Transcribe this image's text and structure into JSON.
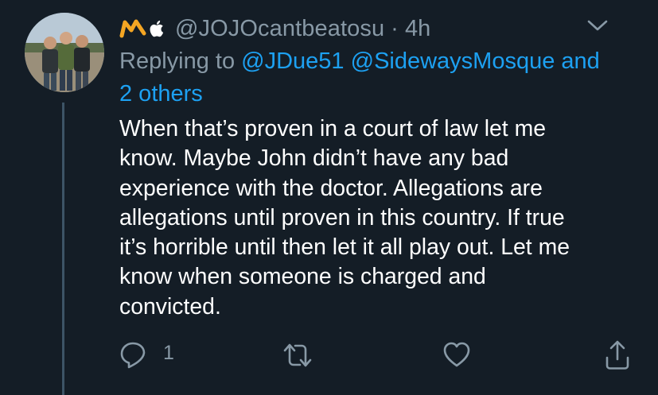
{
  "tweet": {
    "handle": "@JOJOcantbeatosu",
    "separator": "·",
    "time": "4h",
    "replying_prefix": "Replying to ",
    "reply_mention_1": "@JDue51",
    "reply_mention_2": "@SidewaysMosque",
    "reply_and": "and",
    "reply_others": "2 others",
    "body": "When that’s proven in a court of law let me\nknow. Maybe John didn’t have any bad\nexperience with the doctor. Allegations are\nallegations until proven in this country. If true\nit’s horrible until then let it all play out.  Let me\nknow when someone is charged and\nconvicted.",
    "reply_count": "1",
    "icons": {
      "name_emoji": "m-emoji-icon",
      "apple": "apple-logo-icon",
      "menu": "chevron-down-icon",
      "reply": "reply-icon",
      "retweet": "retweet-icon",
      "like": "heart-icon",
      "share": "share-icon"
    }
  },
  "colors": {
    "background": "#141d26",
    "secondary_text": "#8899a6",
    "link": "#1da1f2",
    "primary_text": "#ffffff",
    "thread_line": "#3d5466",
    "m_emoji": "#f5a623"
  }
}
